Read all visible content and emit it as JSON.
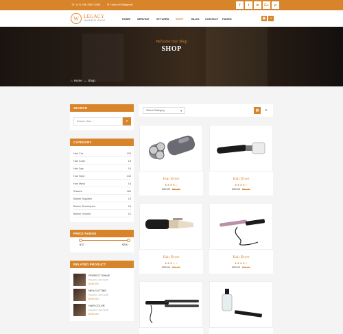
{
  "topbar": {
    "phone": "(+1) 946-3802 8366",
    "email": "hairs.v405@gmail",
    "social": [
      "f",
      "t",
      "in",
      "G+",
      "p"
    ]
  },
  "header": {
    "logo_mark": "W",
    "logo_name": "LEGACY",
    "logo_sub": "BARBER SHOP",
    "nav": [
      "HOME",
      "SERVICE",
      "STYLERS",
      "SHOP",
      "BLOG",
      "CONTACT",
      "PAGES"
    ],
    "active_nav": "SHOP"
  },
  "banner": {
    "welcome": "Welcome Our Shop",
    "title": "SHOP",
    "breadcrumb": [
      "Home",
      "Shop"
    ]
  },
  "sidebar": {
    "search": {
      "title": "SEARCH",
      "placeholder": "Search Here ..."
    },
    "category": {
      "title": "CATEGORY",
      "items": [
        {
          "label": "Hair Cut",
          "count": "103"
        },
        {
          "label": "Hair Color",
          "count": "15"
        },
        {
          "label": "Hair Dye",
          "count": "15"
        },
        {
          "label": "Hair Style",
          "count": "240"
        },
        {
          "label": "Hair Mask",
          "count": "16"
        },
        {
          "label": "Shaves",
          "count": "164"
        },
        {
          "label": "Barber Supplies",
          "count": "10"
        },
        {
          "label": "Barber Techniques",
          "count": "18"
        },
        {
          "label": "Barber Volume",
          "count": "10"
        }
      ]
    },
    "price": {
      "title": "PRICE RANGE",
      "min": "$70",
      "max": "$200"
    },
    "related": {
      "title": "RELATED PRODUCT",
      "items": [
        {
          "title": "PERFECT SHAVE",
          "by": "Posted by John Smith",
          "price": "$190.000"
        },
        {
          "title": "MEN CUTTING",
          "by": "Posted by John Smith",
          "price": "$190.000"
        },
        {
          "title": "HAIR COLOR",
          "by": "Posted by John Smith",
          "price": "$190.000"
        }
      ]
    }
  },
  "shop": {
    "sort_label": "Select Category",
    "products": [
      {
        "title": "Hair Dryer",
        "stars": "★★★★☆",
        "price": "$20.00",
        "old_price": "$24.00"
      },
      {
        "title": "Hair Dryer",
        "stars": "★★★★☆",
        "price": "$20.00",
        "old_price": "$24.00"
      },
      {
        "title": "Hair Dryer",
        "stars": "★★★☆☆",
        "price": "$20.00",
        "old_price": "$24.00"
      },
      {
        "title": "Hair Dryer",
        "stars": "★★★★☆",
        "price": "$20.00",
        "old_price": "$24.00"
      },
      {
        "title": "",
        "stars": "",
        "price": "",
        "old_price": ""
      },
      {
        "title": "",
        "stars": "",
        "price": "",
        "old_price": ""
      }
    ]
  },
  "colors": {
    "accent": "#d8842a",
    "dark": "#1a1410"
  }
}
